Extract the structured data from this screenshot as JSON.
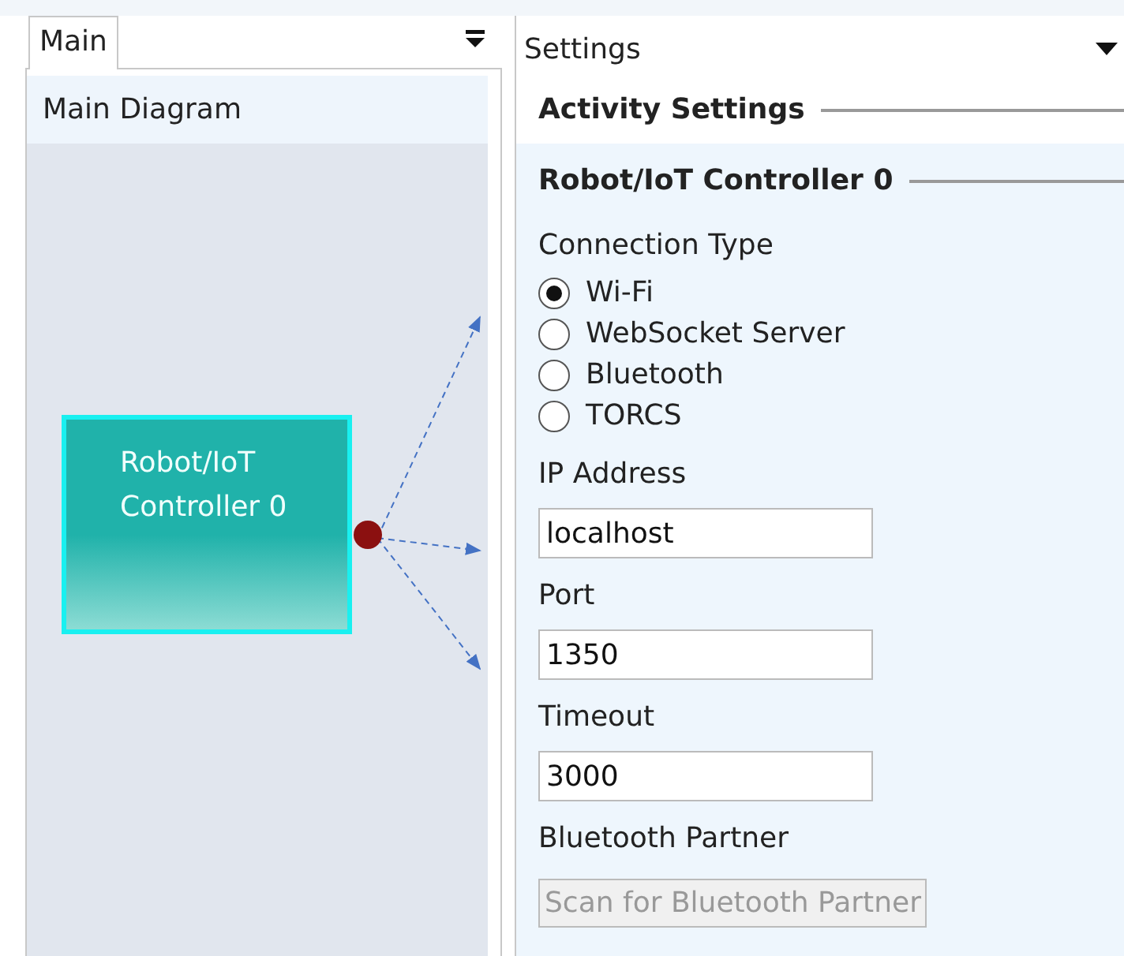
{
  "left_panel": {
    "tab": {
      "label": "Main",
      "selected": true
    },
    "header": "Main Diagram",
    "diagram": {
      "nodes": [
        {
          "label": "Robot/IoT Controller 0"
        }
      ]
    }
  },
  "right_panel": {
    "title": "Settings",
    "section": "Activity Settings",
    "group": "Robot/IoT Controller 0",
    "connection_type": {
      "label": "Connection Type",
      "options": [
        {
          "label": "Wi-Fi",
          "selected": true
        },
        {
          "label": "WebSocket Server",
          "selected": false
        },
        {
          "label": "Bluetooth",
          "selected": false
        },
        {
          "label": "TORCS",
          "selected": false
        }
      ]
    },
    "fields": [
      {
        "label": "IP Address",
        "value": "localhost"
      },
      {
        "label": "Port",
        "value": "1350"
      },
      {
        "label": "Timeout",
        "value": "3000"
      }
    ],
    "bluetooth": {
      "label": "Bluetooth Partner",
      "button": "Scan for Bluetooth Partner",
      "disabled": true
    }
  }
}
